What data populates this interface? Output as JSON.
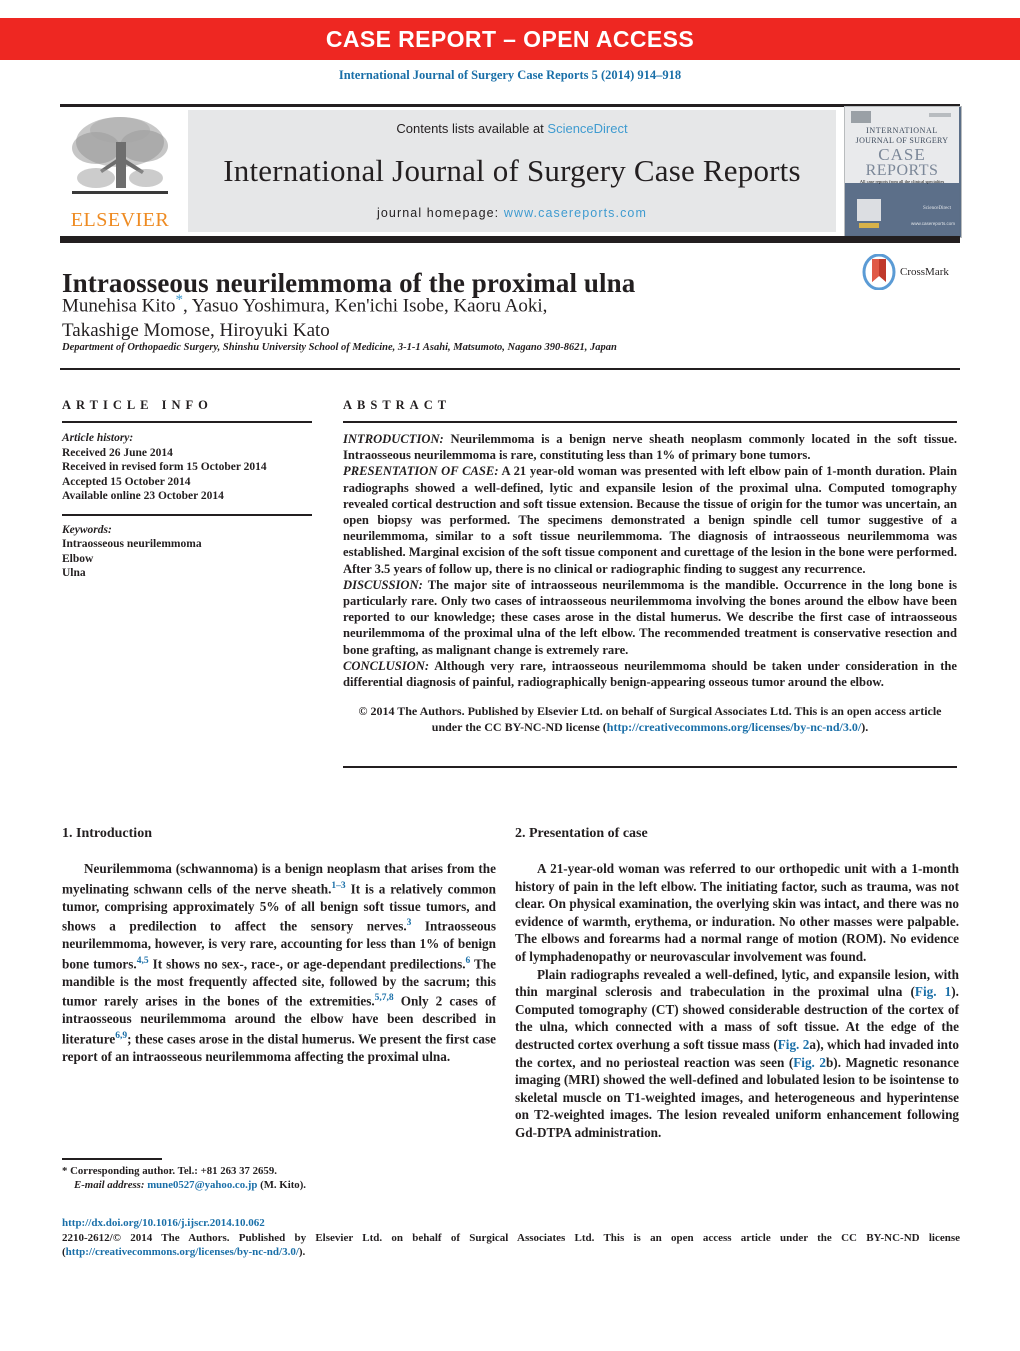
{
  "banner": {
    "text": "CASE REPORT – OPEN ACCESS",
    "bg_color": "#ee2722",
    "text_color": "#ffffff"
  },
  "citation": "International Journal of Surgery Case Reports 5 (2014) 914–918",
  "masthead": {
    "publisher_logo_label": "ELSEVIER",
    "contents_prefix": "Contents lists available at ",
    "contents_link": "ScienceDirect",
    "journal_title": "International Journal of Surgery Case Reports",
    "homepage_prefix": "journal homepage: ",
    "homepage_url": "www.casereports.com",
    "band_bg": "#e6e7e8",
    "link_color": "#3f9bd0",
    "cover": {
      "line1": "INTERNATIONAL",
      "line2": "JOURNAL OF SURGERY",
      "line3": "CASE",
      "line4": "REPORTS",
      "tagline": "All case reports from all the clinical specialties",
      "url": "www.casereports.com"
    }
  },
  "article": {
    "title": "Intraosseous neurilemmoma of the proximal ulna",
    "authors_line1": "Munehisa Kito",
    "authors_star": "*",
    "authors_line1_rest": ", Yasuo Yoshimura, Ken'ichi Isobe, Kaoru Aoki,",
    "authors_line2": "Takashige Momose, Hiroyuki Kato",
    "affiliation": "Department of Orthopaedic Surgery, Shinshu University School of Medicine, 3-1-1 Asahi, Matsumoto, Nagano 390-8621, Japan",
    "crossmark_label": "CrossMark"
  },
  "article_info": {
    "heading": "ARTICLE INFO",
    "history_label": "Article history:",
    "history": [
      "Received 26 June 2014",
      "Received in revised form 15 October 2014",
      "Accepted 15 October 2014",
      "Available online 23 October 2014"
    ],
    "keywords_label": "Keywords:",
    "keywords": [
      "Intraosseous neurilemmoma",
      "Elbow",
      "Ulna"
    ]
  },
  "abstract": {
    "heading": "ABSTRACT",
    "sections": [
      {
        "label": "INTRODUCTION:",
        "text": " Neurilemmoma is a benign nerve sheath neoplasm commonly located in the soft tissue. Intraosseous neurilemmoma is rare, constituting less than 1% of primary bone tumors."
      },
      {
        "label": "PRESENTATION OF CASE:",
        "text": " A 21 year-old woman was presented with left elbow pain of 1-month duration. Plain radiographs showed a well-defined, lytic and expansile lesion of the proximal ulna. Computed tomography revealed cortical destruction and soft tissue extension. Because the tissue of origin for the tumor was uncertain, an open biopsy was performed. The specimens demonstrated a benign spindle cell tumor suggestive of a neurilemmoma, similar to a soft tissue neurilemmoma. The diagnosis of intraosseous neurilemmoma was established. Marginal excision of the soft tissue component and curettage of the lesion in the bone were performed. After 3.5 years of follow up, there is no clinical or radiographic finding to suggest any recurrence."
      },
      {
        "label": "DISCUSSION:",
        "text": " The major site of intraosseous neurilemmoma is the mandible. Occurrence in the long bone is particularly rare. Only two cases of intraosseous neurilemmoma involving the bones around the elbow have been reported to our knowledge; these cases arose in the distal humerus. We describe the first case of intraosseous neurilemmoma of the proximal ulna of the left elbow. The recommended treatment is conservative resection and bone grafting, as malignant change is extremely rare."
      },
      {
        "label": "CONCLUSION:",
        "text": " Although very rare, intraosseous neurilemmoma should be taken under consideration in the differential diagnosis of painful, radiographically benign-appearing osseous tumor around the elbow."
      }
    ],
    "copyright_part1": "© 2014 The Authors. Published by Elsevier Ltd. on behalf of Surgical Associates Ltd. This is an open access article under the CC BY-NC-ND license (",
    "copyright_link": "http://creativecommons.org/licenses/by-nc-nd/3.0/",
    "copyright_part2": ")."
  },
  "body": {
    "left": {
      "section_number_title": "1.  Introduction",
      "paragraph_parts": [
        "Neurilemmoma (schwannoma) is a benign neoplasm that arises from the myelinating schwann cells of the nerve sheath.",
        "1–3",
        " It is a relatively common tumor, comprising approximately 5% of all benign soft tissue tumors, and shows a predilection to affect the sensory nerves.",
        "3",
        " Intraosseous neurilemmoma, however, is very rare, accounting for less than 1% of benign bone tumors.",
        "4,5",
        " It shows no sex-, race-, or age-dependant predilections.",
        "6",
        " The mandible is the most frequently affected site, followed by the sacrum; this tumor rarely arises in the bones of the extremities.",
        "5,7,8",
        " Only 2 cases of intraosseous neurilemmoma around the elbow have been described in literature",
        "6,9",
        "; these cases arose in the distal humerus. We present the first case report of an intraosseous neurilemmoma affecting the proximal ulna."
      ]
    },
    "right": {
      "section_number_title": "2.  Presentation of case",
      "paragraph1": "A 21-year-old woman was referred to our orthopedic unit with a 1-month history of pain in the left elbow. The initiating factor, such as trauma, was not clear. On physical examination, the overlying skin was intact, and there was no evidence of warmth, erythema, or induration. No other masses were palpable. The elbows and forearms had a normal range of motion (ROM). No evidence of lymphadenopathy or neurovascular involvement was found.",
      "paragraph2_parts": [
        "Plain radiographs revealed a well-defined, lytic, and expansile lesion, with thin marginal sclerosis and trabeculation in the proximal ulna (",
        "Fig. 1",
        "). Computed tomography (CT) showed considerable destruction of the cortex of the ulna, which connected with a mass of soft tissue. At the edge of the destructed cortex overhung a soft tissue mass (",
        "Fig. 2",
        "a), which had invaded into the cortex, and no periosteal reaction was seen (",
        "Fig. 2",
        "b). Magnetic resonance imaging (MRI) showed the well-defined and lobulated lesion to be isointense to skeletal muscle on T1-weighted images, and heterogeneous and hyperintense on T2-weighted images. The lesion revealed uniform enhancement following Gd-DTPA administration."
      ]
    }
  },
  "footnote": {
    "marker": "*",
    "corresponding": " Corresponding author. Tel.: +81 263 37 2659.",
    "email_label": "E-mail address:",
    "email": "mune0527@yahoo.co.jp",
    "email_suffix": " (M. Kito)."
  },
  "footer": {
    "doi": "http://dx.doi.org/10.1016/j.ijscr.2014.10.062",
    "issn_line": "2210-2612/© 2014 The Authors. Published by Elsevier Ltd. on behalf of Surgical Associates Ltd. This is an open access article under the CC BY-NC-ND license (",
    "license_link": "http://creativecommons.org/licenses/by-nc-nd/3.0/",
    "issn_line_end": ")."
  },
  "colors": {
    "accent_red": "#ee2722",
    "link_blue": "#1a6fa8",
    "sciencedirect_blue": "#3f9bd0",
    "elsevier_orange": "#ee8b22",
    "band_gray": "#e6e7e8",
    "ink": "#231f20"
  }
}
